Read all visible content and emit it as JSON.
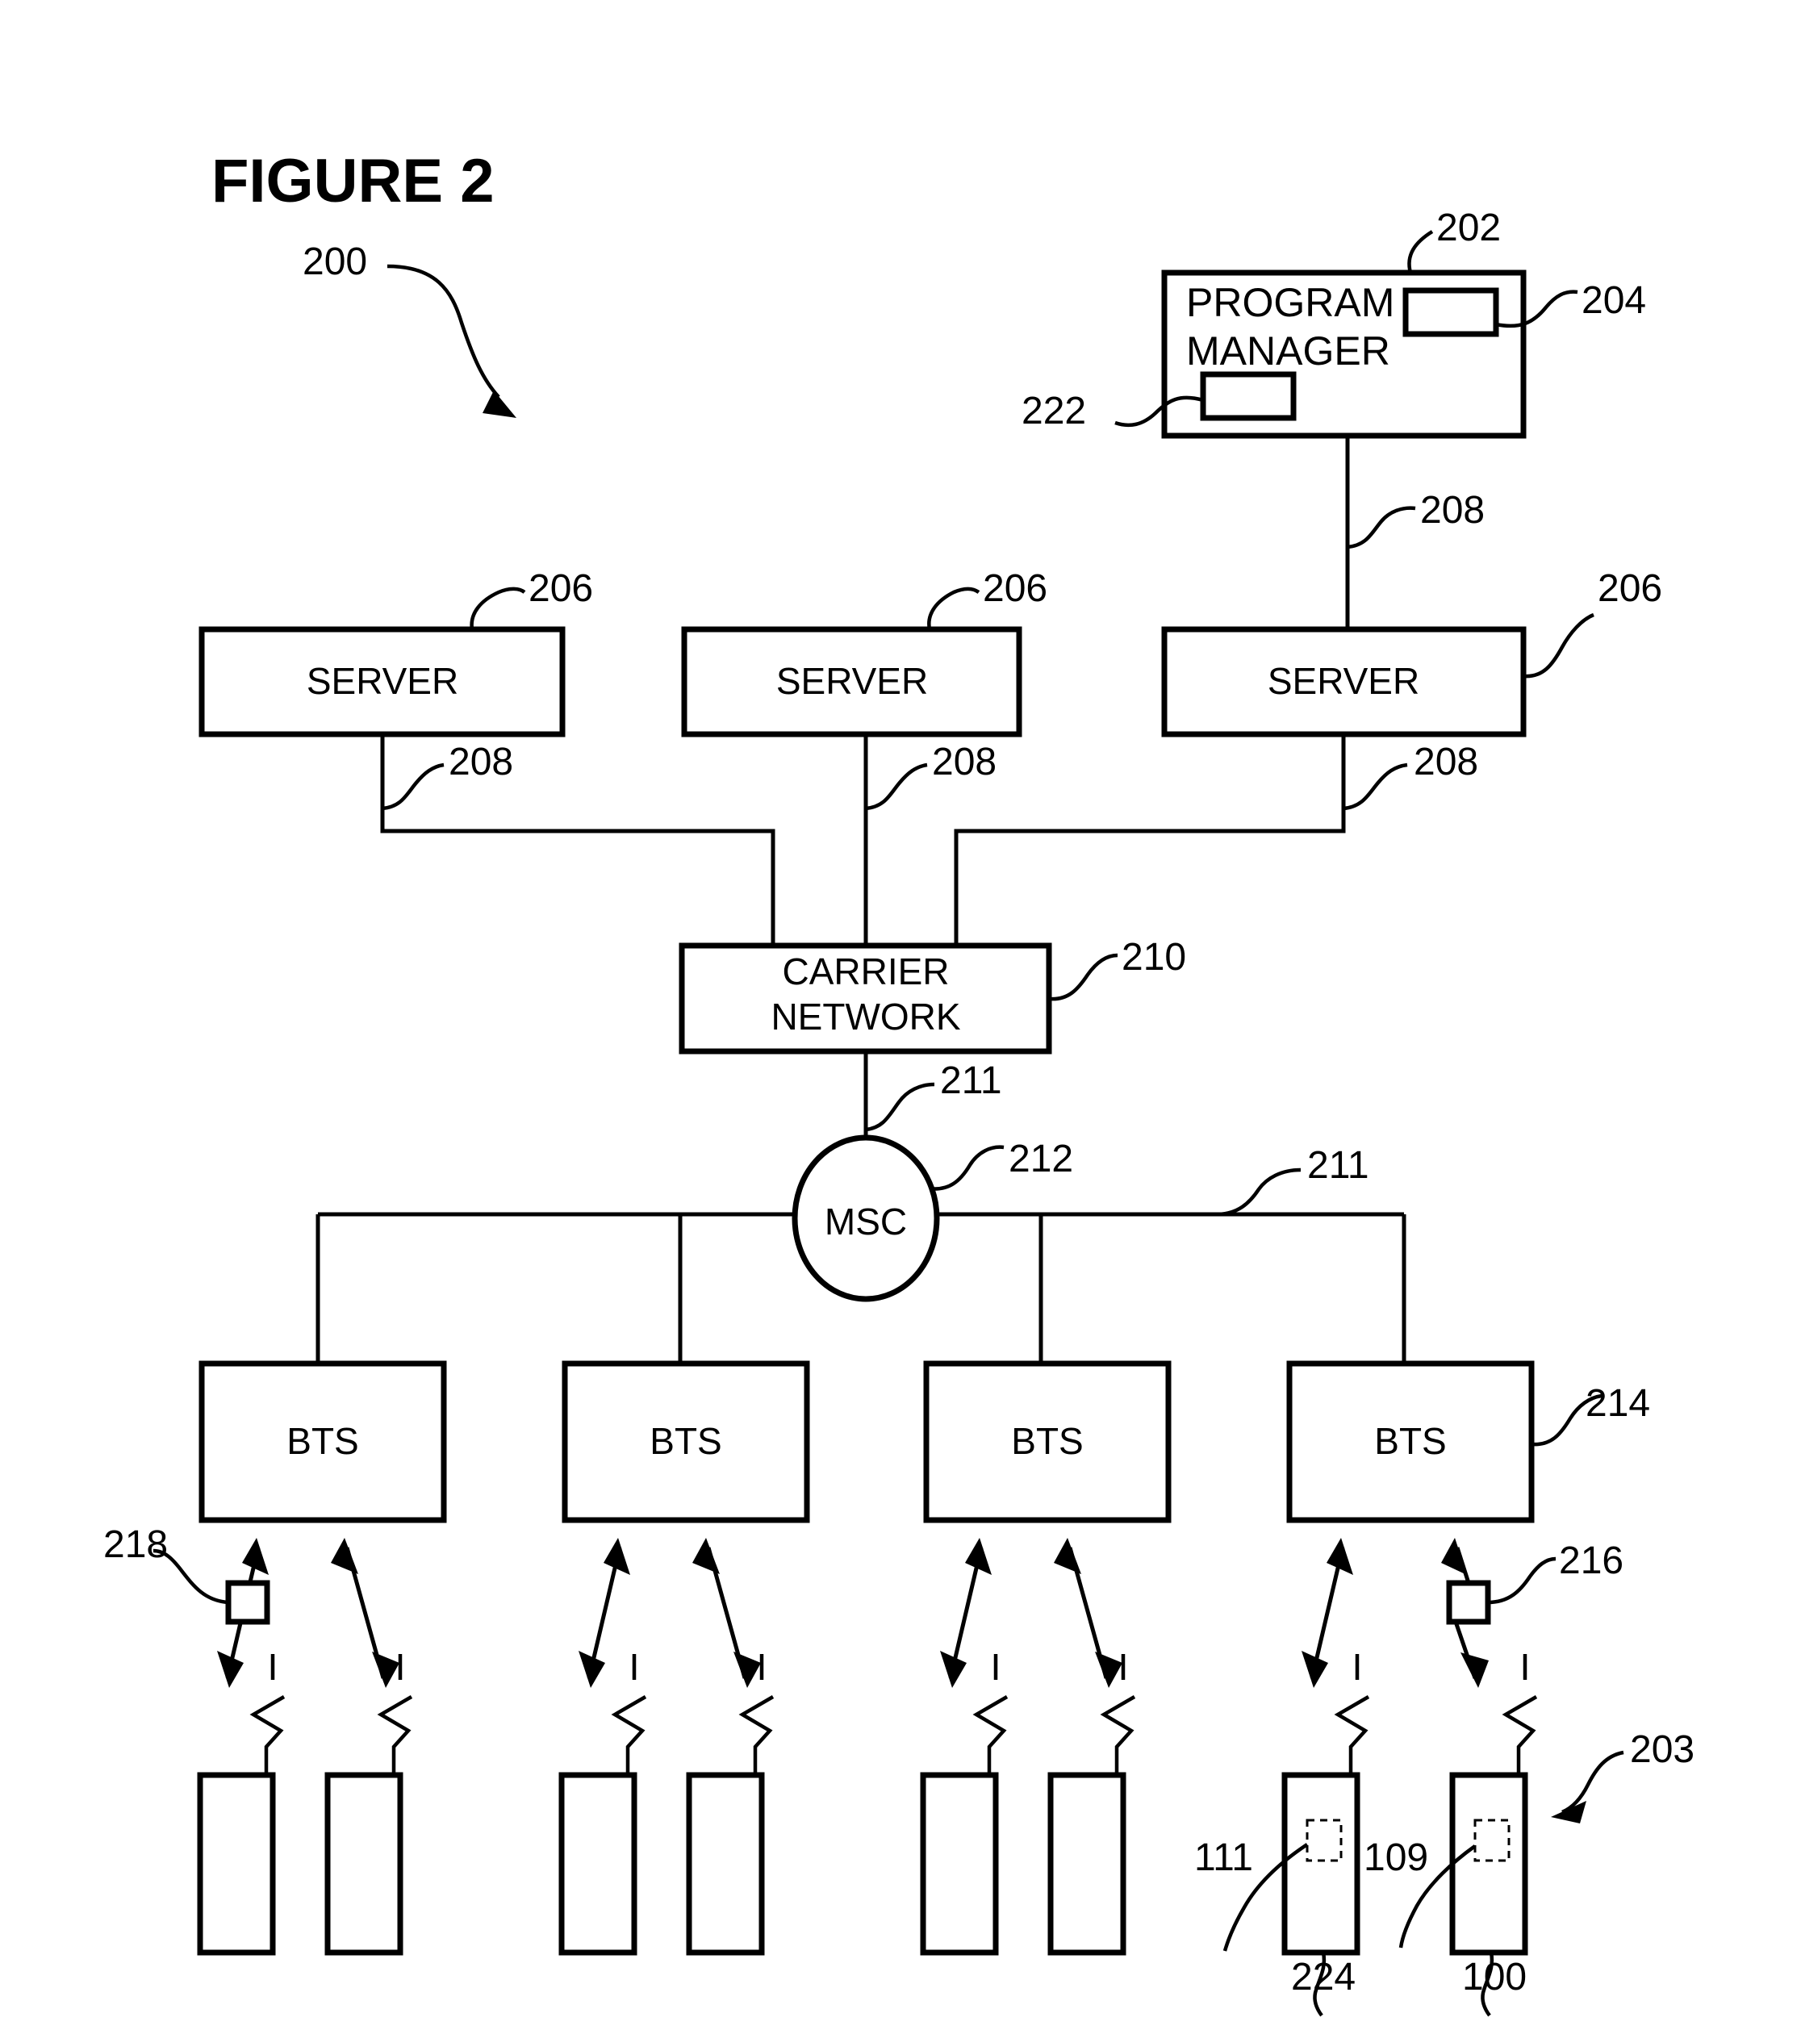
{
  "figure": {
    "title": "FIGURE 2",
    "system_ref": "200"
  },
  "nodes": {
    "program_manager": {
      "label_line1": "PROGRAM",
      "label_line2": "MANAGER",
      "ref": "202",
      "module_top_ref": "204",
      "module_bottom_ref": "222"
    },
    "servers": [
      {
        "label": "SERVER",
        "ref": "206"
      },
      {
        "label": "SERVER",
        "ref": "206"
      },
      {
        "label": "SERVER",
        "ref": "206"
      }
    ],
    "carrier_network": {
      "label_line1": "CARRIER",
      "label_line2": "NETWORK",
      "ref": "210"
    },
    "msc": {
      "label": "MSC",
      "ref": "212"
    },
    "bts": [
      {
        "label": "BTS"
      },
      {
        "label": "BTS"
      },
      {
        "label": "BTS"
      },
      {
        "label": "BTS",
        "ref": "214"
      }
    ],
    "handsets": [
      {
        "ref": null,
        "module_ref": null
      },
      {
        "ref": null,
        "module_ref": null
      },
      {
        "ref": null,
        "module_ref": null
      },
      {
        "ref": null,
        "module_ref": null
      },
      {
        "ref": null,
        "module_ref": null
      },
      {
        "ref": null,
        "module_ref": null
      },
      {
        "ref": "224",
        "module_ref": "111"
      },
      {
        "ref": "100",
        "module_ref": "109"
      }
    ],
    "handset_group_ref": "203"
  },
  "links": {
    "pm_to_server_ref": "208",
    "server_to_carrier_refs": [
      "208",
      "208",
      "208"
    ],
    "carrier_to_msc_ref": "211",
    "msc_to_bts_ref": "211"
  },
  "air_interface": {
    "left_marker_ref": "218",
    "right_marker_ref": "216"
  },
  "refs": {
    "r100": "100",
    "r109": "109",
    "r111": "111",
    "r200": "200",
    "r202": "202",
    "r203": "203",
    "r204": "204",
    "r206_a": "206",
    "r206_b": "206",
    "r206_c": "206",
    "r208_pm": "208",
    "r208_a": "208",
    "r208_b": "208",
    "r208_c": "208",
    "r210": "210",
    "r211_a": "211",
    "r211_b": "211",
    "r212": "212",
    "r214": "214",
    "r216": "216",
    "r218": "218",
    "r222": "222",
    "r224": "224"
  },
  "colors": {
    "ink": "#000000",
    "paper": "#ffffff"
  }
}
